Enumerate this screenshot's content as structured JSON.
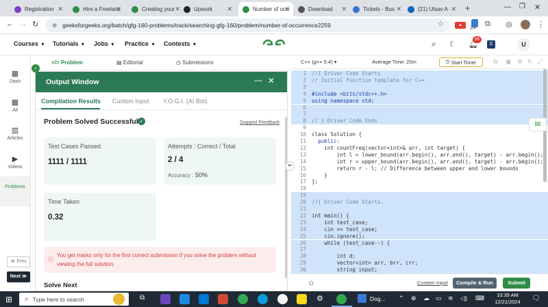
{
  "browser": {
    "tabs": [
      {
        "label": "Registration",
        "color": "#7a3fc4"
      },
      {
        "label": "Hire a Freelancer",
        "color": "#2f8d46"
      },
      {
        "label": "Creating your",
        "color": "#2f8d46"
      },
      {
        "label": "Upwork",
        "color": "#222222"
      },
      {
        "label": "Number of occurrence",
        "color": "#2f8d46"
      },
      {
        "label": "Download",
        "color": "#555555"
      },
      {
        "label": "Tickets - Bus",
        "color": "#3a6fd8"
      },
      {
        "label": "(21) Utsav A",
        "color": "#0a66c2"
      }
    ],
    "url": "geeksforgeeks.org/batch/gfg-160-problems/track/searching-gfg-160/problem/number-of-occurrence2259",
    "ext_badge": "1/4"
  },
  "site": {
    "nav": [
      "Courses",
      "Tutorials",
      "Jobs",
      "Practice",
      "Contests"
    ],
    "notif_count": "96",
    "avatar": "U",
    "logo_color": "#2f8d46"
  },
  "rail": {
    "items": [
      {
        "label": "Dash",
        "icon": "dash-icon"
      },
      {
        "label": "All",
        "icon": "grid-icon"
      },
      {
        "label": "Articles",
        "icon": "book-icon"
      },
      {
        "label": "Videos",
        "icon": "video-icon"
      },
      {
        "label": "Problems",
        "icon": "code-icon"
      }
    ],
    "prev": "≪ Prev",
    "next": "Next ≫"
  },
  "problem_tabs": [
    "Problem",
    "Editorial",
    "Submissions"
  ],
  "output": {
    "title": "Output Window",
    "tabs": [
      "Compilation Results",
      "Custom Input",
      "Y.O.G.I. (AI Bot)"
    ],
    "status": "Problem Solved Successfully",
    "suggest": "Suggest Feedback",
    "cases_label": "Test Cases Passed",
    "cases_value": "1111 / 1111",
    "attempts_label": "Attempts : Correct / Total",
    "attempts_value": "2 / 4",
    "accuracy_label": "Accuracy :",
    "accuracy_value": "50%",
    "time_label": "Time Taken",
    "time_value": "0.32",
    "warning": "You get marks only for the first correct submission if you solve the problem without viewing the full solution.",
    "solve_next": "Solve Next"
  },
  "editor": {
    "language": "C++ (g++ 5.4)",
    "avg_time": "Average Time: 20m",
    "timer": "Start Timer",
    "custom_input": "Custom Input",
    "compile_run": "Compile & Run",
    "submit": "Submit"
  },
  "code": [
    {
      "n": "1",
      "t": "//{ Driver Code Starts",
      "hl": true,
      "c": "cm"
    },
    {
      "n": "2",
      "t": "// Initial function template for C++",
      "hl": true,
      "c": "cm"
    },
    {
      "n": "3",
      "t": "",
      "hl": true,
      "c": ""
    },
    {
      "n": "4",
      "t": "#include <bits/stdc++.h>",
      "hl": true,
      "c": "pp"
    },
    {
      "n": "5",
      "t": "using namespace std;",
      "hl": true,
      "c": "kw"
    },
    {
      "n": "6",
      "t": "",
      "hl": true,
      "c": ""
    },
    {
      "n": "7",
      "t": "",
      "hl": true,
      "c": ""
    },
    {
      "n": "8",
      "t": "// } Driver Code Ends",
      "hl": true,
      "c": "cm"
    },
    {
      "n": "9",
      "t": "",
      "hl": false,
      "c": ""
    },
    {
      "n": "10",
      "t": "class Solution {",
      "hl": false,
      "c": ""
    },
    {
      "n": "11",
      "t": "  public:",
      "hl": false,
      "c": "kw"
    },
    {
      "n": "12",
      "t": "    int countFreq(vector<int>& arr, int target) {",
      "hl": false,
      "c": ""
    },
    {
      "n": "13",
      "t": "        int l = lower_bound(arr.begin(), arr.end(), target) - arr.begin();",
      "hl": false,
      "c": ""
    },
    {
      "n": "14",
      "t": "        int r = upper_bound(arr.begin(), arr.end(), target) - arr.begin();",
      "hl": false,
      "c": ""
    },
    {
      "n": "15",
      "t": "        return r - l; // Difference between upper and lower bounds",
      "hl": false,
      "c": ""
    },
    {
      "n": "16",
      "t": "    }",
      "hl": false,
      "c": ""
    },
    {
      "n": "17",
      "t": "};",
      "hl": false,
      "c": ""
    },
    {
      "n": "18",
      "t": "",
      "hl": false,
      "c": ""
    },
    {
      "n": "19",
      "t": "",
      "hl": true,
      "c": ""
    },
    {
      "n": "20",
      "t": "//{ Driver Code Starts.",
      "hl": true,
      "c": "cm"
    },
    {
      "n": "21",
      "t": "",
      "hl": true,
      "c": ""
    },
    {
      "n": "22",
      "t": "int main() {",
      "hl": true,
      "c": ""
    },
    {
      "n": "23",
      "t": "    int test_case;",
      "hl": true,
      "c": ""
    },
    {
      "n": "24",
      "t": "    cin >> test_case;",
      "hl": true,
      "c": ""
    },
    {
      "n": "25",
      "t": "    cin.ignore();",
      "hl": true,
      "c": ""
    },
    {
      "n": "26",
      "t": "    while (test_case--) {",
      "hl": true,
      "c": ""
    },
    {
      "n": "27",
      "t": "",
      "hl": true,
      "c": ""
    },
    {
      "n": "28",
      "t": "        int d;",
      "hl": true,
      "c": ""
    },
    {
      "n": "29",
      "t": "        vector<int> arr, brr, crr;",
      "hl": true,
      "c": ""
    },
    {
      "n": "30",
      "t": "        string input;",
      "hl": true,
      "c": ""
    }
  ],
  "taskbar": {
    "search_placeholder": "Type here to search",
    "app_label": "Dog...",
    "time": "10:39 AM",
    "date": "12/21/2024"
  }
}
